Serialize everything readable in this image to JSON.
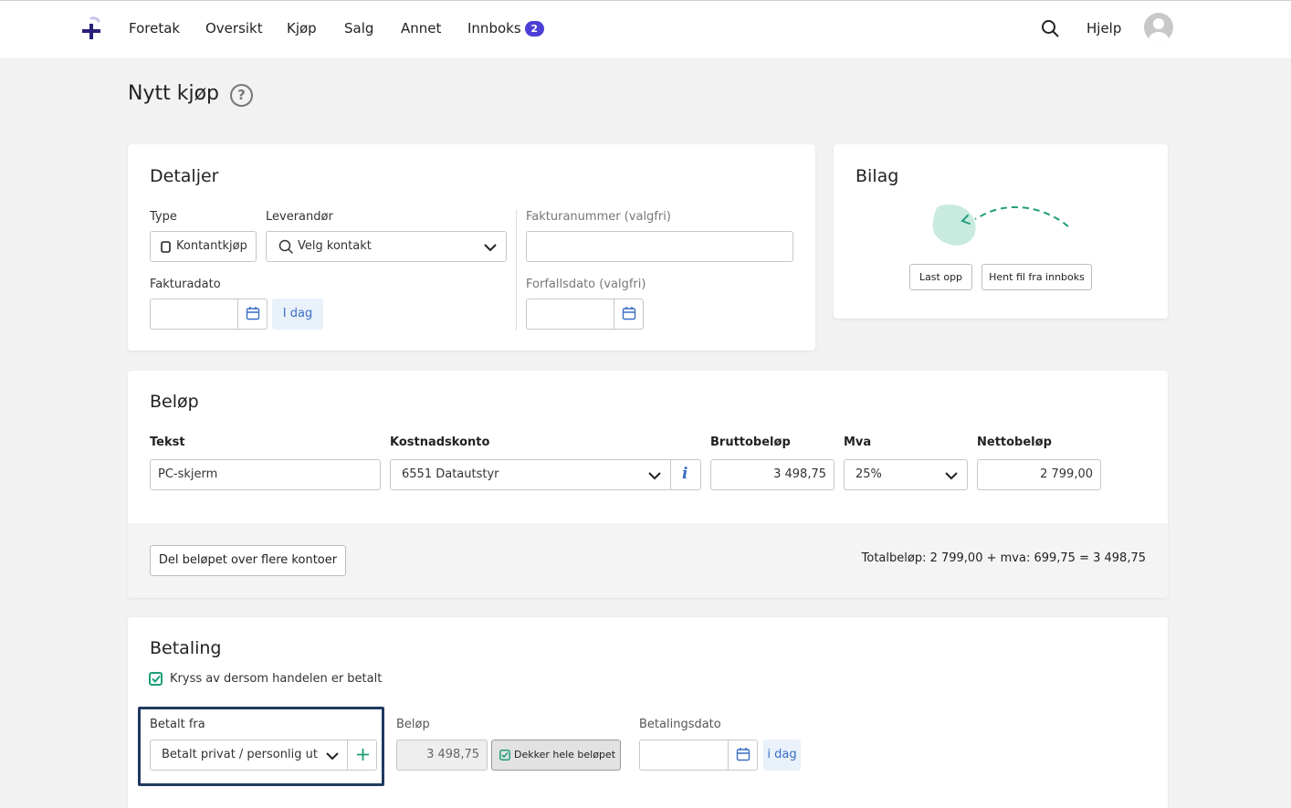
{
  "nav": {
    "items": [
      "Foretak",
      "Oversikt",
      "Kjøp",
      "Salg",
      "Annet",
      "Innboks"
    ],
    "inbox_count": "2",
    "help": "Hjelp"
  },
  "page": {
    "title": "Nytt kjøp",
    "help_glyph": "?"
  },
  "details": {
    "title": "Detaljer",
    "type_label": "Type",
    "type_value": "Kontantkjøp",
    "supplier_label": "Leverandør",
    "supplier_placeholder": "Velg kontakt",
    "invoice_number_label": "Fakturanummer (valgfri)",
    "invoice_date_label": "Fakturadato",
    "today_label": "I dag",
    "due_date_label": "Forfallsdato (valgfri)"
  },
  "attachment": {
    "title": "Bilag",
    "upload_label": "Last opp",
    "inbox_label": "Hent fil fra innboks"
  },
  "amount": {
    "title": "Beløp",
    "text_label": "Tekst",
    "text_value": "PC-skjerm",
    "account_label": "Kostnadskonto",
    "account_value": "6551 Datautstyr",
    "info_glyph": "i",
    "gross_label": "Bruttobeløp",
    "gross_value": "3 498,75",
    "vat_label": "Mva",
    "vat_value": "25%",
    "net_label": "Nettobeløp",
    "net_value": "2 799,00",
    "split_label": "Del beløpet over flere kontoer",
    "total_text": "Totalbeløp: 2 799,00 + mva: 699,75 = 3 498,75"
  },
  "payment": {
    "title": "Betaling",
    "paid_checkbox_label": "Kryss av dersom handelen er betalt",
    "paid_checked": true,
    "paid_from_label": "Betalt fra",
    "paid_from_value": "Betalt privat / personlig utlegg",
    "amount_label": "Beløp",
    "amount_value": "3 498,75",
    "covers_label": "Dekker hele beløpet",
    "date_label": "Betalingsdato",
    "today_label": "i dag"
  },
  "colors": {
    "accent_purple": "#4b3fd6",
    "green": "#1e9e78",
    "link_blue": "#3a6fc4",
    "highlight_border": "#1f3a5f"
  },
  "icons": [
    "logo-plus-icon",
    "search-icon",
    "avatar-icon",
    "help-icon",
    "type-icon",
    "search-icon",
    "chevron-down-icon",
    "calendar-icon",
    "upload-illustration-icon",
    "info-icon",
    "checkbox-icon",
    "plus-icon",
    "check-icon"
  ]
}
